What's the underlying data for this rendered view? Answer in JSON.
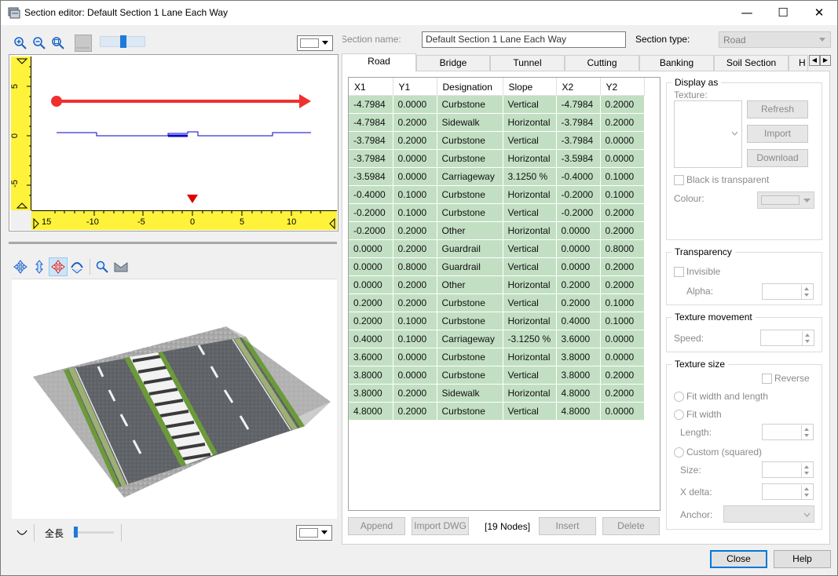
{
  "window": {
    "title": "Section editor: Default Section 1 Lane Each Way",
    "minimize_glyph": "—",
    "maximize_glyph": "☐",
    "close_glyph": "✕"
  },
  "top_view": {
    "toolbar_icons": [
      "zoom-in-icon",
      "zoom-out-icon",
      "zoom-fit-icon",
      "grid-icon"
    ],
    "zoom_level": 0.5,
    "y_ticks": [
      "5",
      "0",
      "-5"
    ],
    "x_ticks": [
      "15",
      "-10",
      "-5",
      "0",
      "5",
      "10"
    ]
  },
  "view3d": {
    "toolbar_icons": [
      "rotate-icon",
      "pan-vertical-icon",
      "move-icon",
      "orbit-icon",
      "zoom-icon",
      "reset-view-icon"
    ],
    "length_label": "全長",
    "length_level": 0.02
  },
  "section_name": {
    "label": "Section name:",
    "value": "Default Section 1 Lane Each Way"
  },
  "section_type": {
    "label": "Section type:",
    "value": "Road"
  },
  "tabs": [
    "Road",
    "Bridge",
    "Tunnel",
    "Cutting",
    "Banking",
    "Soil Section",
    "H"
  ],
  "grid": {
    "columns": [
      "X1",
      "Y1",
      "Designation",
      "Slope",
      "X2",
      "Y2"
    ],
    "rows": [
      [
        "-4.7984",
        "0.0000",
        "Curbstone",
        "Vertical",
        "-4.7984",
        "0.2000"
      ],
      [
        "-4.7984",
        "0.2000",
        "Sidewalk",
        "Horizontal",
        "-3.7984",
        "0.2000"
      ],
      [
        "-3.7984",
        "0.2000",
        "Curbstone",
        "Vertical",
        "-3.7984",
        "0.0000"
      ],
      [
        "-3.7984",
        "0.0000",
        "Curbstone",
        "Horizontal",
        "-3.5984",
        "0.0000"
      ],
      [
        "-3.5984",
        "0.0000",
        "Carriageway",
        "3.1250 %",
        "-0.4000",
        "0.1000"
      ],
      [
        "-0.4000",
        "0.1000",
        "Curbstone",
        "Horizontal",
        "-0.2000",
        "0.1000"
      ],
      [
        "-0.2000",
        "0.1000",
        "Curbstone",
        "Vertical",
        "-0.2000",
        "0.2000"
      ],
      [
        "-0.2000",
        "0.2000",
        "Other",
        "Horizontal",
        "0.0000",
        "0.2000"
      ],
      [
        "0.0000",
        "0.2000",
        "Guardrail",
        "Vertical",
        "0.0000",
        "0.8000"
      ],
      [
        "0.0000",
        "0.8000",
        "Guardrail",
        "Vertical",
        "0.0000",
        "0.2000"
      ],
      [
        "0.0000",
        "0.2000",
        "Other",
        "Horizontal",
        "0.2000",
        "0.2000"
      ],
      [
        "0.2000",
        "0.2000",
        "Curbstone",
        "Vertical",
        "0.2000",
        "0.1000"
      ],
      [
        "0.2000",
        "0.1000",
        "Curbstone",
        "Horizontal",
        "0.4000",
        "0.1000"
      ],
      [
        "0.4000",
        "0.1000",
        "Carriageway",
        "-3.1250 %",
        "3.6000",
        "0.0000"
      ],
      [
        "3.6000",
        "0.0000",
        "Curbstone",
        "Horizontal",
        "3.8000",
        "0.0000"
      ],
      [
        "3.8000",
        "0.0000",
        "Curbstone",
        "Vertical",
        "3.8000",
        "0.2000"
      ],
      [
        "3.8000",
        "0.2000",
        "Sidewalk",
        "Horizontal",
        "4.8000",
        "0.2000"
      ],
      [
        "4.8000",
        "0.2000",
        "Curbstone",
        "Vertical",
        "4.8000",
        "0.0000"
      ]
    ]
  },
  "grid_buttons": {
    "append": "Append",
    "import_dwg": "Import DWG",
    "node_count": "[19 Nodes]",
    "insert": "Insert",
    "delete": "Delete"
  },
  "display_as": {
    "title": "Display as",
    "texture_label": "Texture:",
    "refresh": "Refresh",
    "import": "Import",
    "download": "Download",
    "black_transparent": "Black is transparent",
    "colour_label": "Colour:"
  },
  "transparency": {
    "title": "Transparency",
    "invisible": "Invisible",
    "alpha_label": "Alpha:"
  },
  "texture_movement": {
    "title": "Texture movement",
    "speed_label": "Speed:"
  },
  "texture_size": {
    "title": "Texture size",
    "reverse": "Reverse",
    "fit_width_length": "Fit width and length",
    "fit_width": "Fit width",
    "length_label": "Length:",
    "custom": "Custom (squared)",
    "size_label": "Size:",
    "xdelta_label": "X delta:",
    "anchor_label": "Anchor:"
  },
  "footer": {
    "close": "Close",
    "help": "Help"
  },
  "colors": {
    "arrow": "#f03030",
    "ruler": "#fff23a",
    "grid_cell": "#c2dfc3",
    "profile": "#0000cc",
    "accent": "#0078d7"
  }
}
